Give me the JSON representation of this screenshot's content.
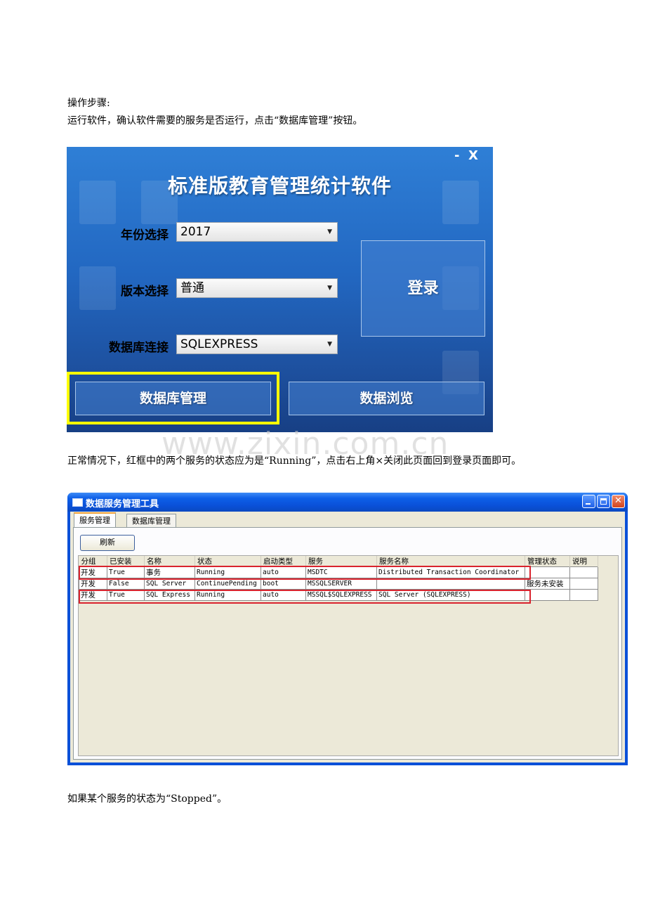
{
  "paragraphs": {
    "steps_heading": "操作步骤:",
    "step1": "运行软件，确认软件需要的服务是否运行，点击“数据库管理”按钮。",
    "step2": "正常情况下，红框中的两个服务的状态应为是“Running”，点击右上角×关闭此页面回到登录页面即可。",
    "step3": "如果某个服务的状态为“Stopped”。"
  },
  "login_window": {
    "title": "标准版教育管理统计软件",
    "minimize": "-",
    "close": "X",
    "year_label": "年份选择",
    "year_value": "2017",
    "version_label": "版本选择",
    "version_value": "普通",
    "db_label": "数据库连接",
    "db_value": "SQLEXPRESS",
    "login_button": "登录",
    "db_manage_button": "数据库管理",
    "data_browse_button": "数据浏览",
    "highlight_color": "#ffff00",
    "background_color": "#2267c1"
  },
  "watermark": "www.zixin.com.cn",
  "service_window": {
    "title": "数据服务管理工具",
    "tabs": [
      "服务管理",
      "数据库管理"
    ],
    "active_tab": 0,
    "refresh_button": "刷新",
    "columns": [
      "分组",
      "已安装",
      "名称",
      "状态",
      "启动类型",
      "服务",
      "服务名称",
      "管理状态",
      "说明"
    ],
    "rows": [
      [
        "开发",
        "True",
        "事务",
        "Running",
        "auto",
        "MSDTC",
        "Distributed Transaction Coordinator",
        "",
        ""
      ],
      [
        "开发",
        "False",
        "SQL Server",
        "ContinuePending",
        "boot",
        "MSSQLSERVER",
        "",
        "服务未安装",
        ""
      ],
      [
        "开发",
        "True",
        "SQL Express",
        "Running",
        "auto",
        "MSSQL$SQLEXPRESS",
        "SQL Server (SQLEXPRESS)",
        "",
        ""
      ]
    ],
    "highlighted_rows": [
      0,
      2
    ],
    "highlight_color": "#d9232e"
  }
}
